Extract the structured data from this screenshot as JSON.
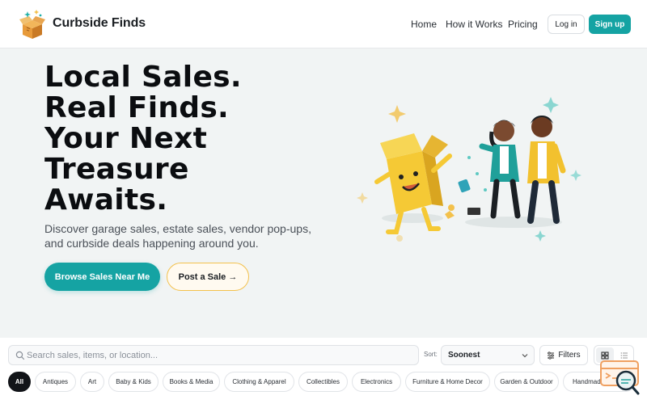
{
  "header": {
    "brand": "Curbside Finds",
    "logo_icon": "open-box-sparkles-icon",
    "nav": [
      "Home",
      "How it Works",
      "Pricing"
    ],
    "login_label": "Log in",
    "signup_label": "Sign up"
  },
  "hero": {
    "headline_lines": [
      "Local Sales.",
      "Real Finds.",
      "Your Next",
      "Treasure",
      "Awaits."
    ],
    "subtext": "Discover garage sales, estate sales, vendor pop-ups, and curbside deals happening around you.",
    "primary_cta": "Browse Sales Near Me",
    "secondary_cta": "Post a Sale →",
    "illustration_icon": "treasure-box-friends-illustration"
  },
  "toolbar": {
    "search_placeholder": "Search sales, items, or location...",
    "sort_label": "Sort:",
    "sort_value": "Soonest",
    "filters_label": "Filters",
    "view_modes": [
      "grid-icon",
      "list-icon"
    ]
  },
  "categories": [
    "All",
    "Antiques",
    "Art",
    "Baby & Kids",
    "Books & Media",
    "Clothing & Apparel",
    "Collectibles",
    "Electronics",
    "Furniture & Home Decor",
    "Garden & Outdoor",
    "Handmade & Crafts"
  ],
  "colors": {
    "accent": "#15a3a3",
    "accent_border": "#f3c14c",
    "dark": "#121418"
  }
}
